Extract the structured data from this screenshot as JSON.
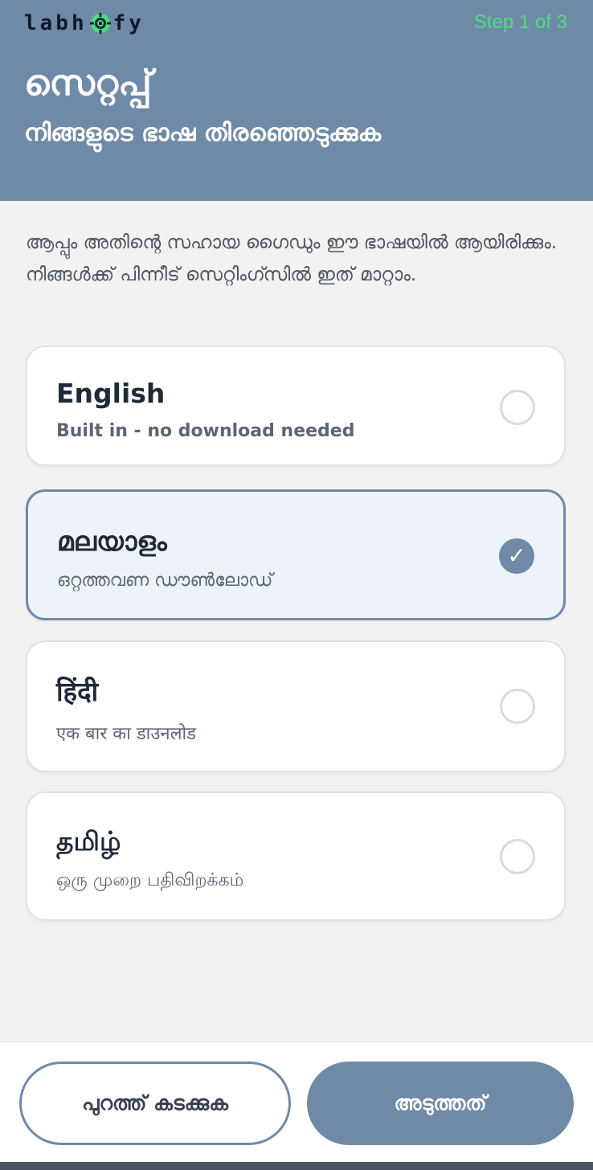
{
  "header": {
    "logo_left": "labh",
    "logo_right": "fy",
    "step": "Step 1 of 3",
    "title": "സെറ്റപ്പ്",
    "subtitle": "നിങ്ങളുടെ ഭാഷ തിരഞ്ഞെടുക്കുക"
  },
  "description": "ആപ്പും അതിന്റെ സഹായ ഗൈഡും ഈ ഭാഷയിൽ ആയിരിക്കും. നിങ്ങൾക്ക് പിന്നീട് സെറ്റിംഗ്സിൽ ഇത് മാറ്റാം.",
  "languages": [
    {
      "name": "English",
      "sub": "Built in - no download needed",
      "selected": false
    },
    {
      "name": "മലയാളം",
      "sub": "ഒറ്റത്തവണ ഡൗൺലോഡ്",
      "selected": true
    },
    {
      "name": "हिंदी",
      "sub": "एक बार का डाउनलोड",
      "selected": false
    },
    {
      "name": "தமிழ்",
      "sub": "ஒரு முறை பதிவிறக்கம்",
      "selected": false
    }
  ],
  "check_glyph": "✓",
  "footer": {
    "skip_label": "പുറത്ത് കടക്കുക",
    "next_label": "അടുത്തത്"
  },
  "colors": {
    "primary": "#6e8aa6",
    "step_green": "#4ade80",
    "background": "#f2f2f3"
  }
}
